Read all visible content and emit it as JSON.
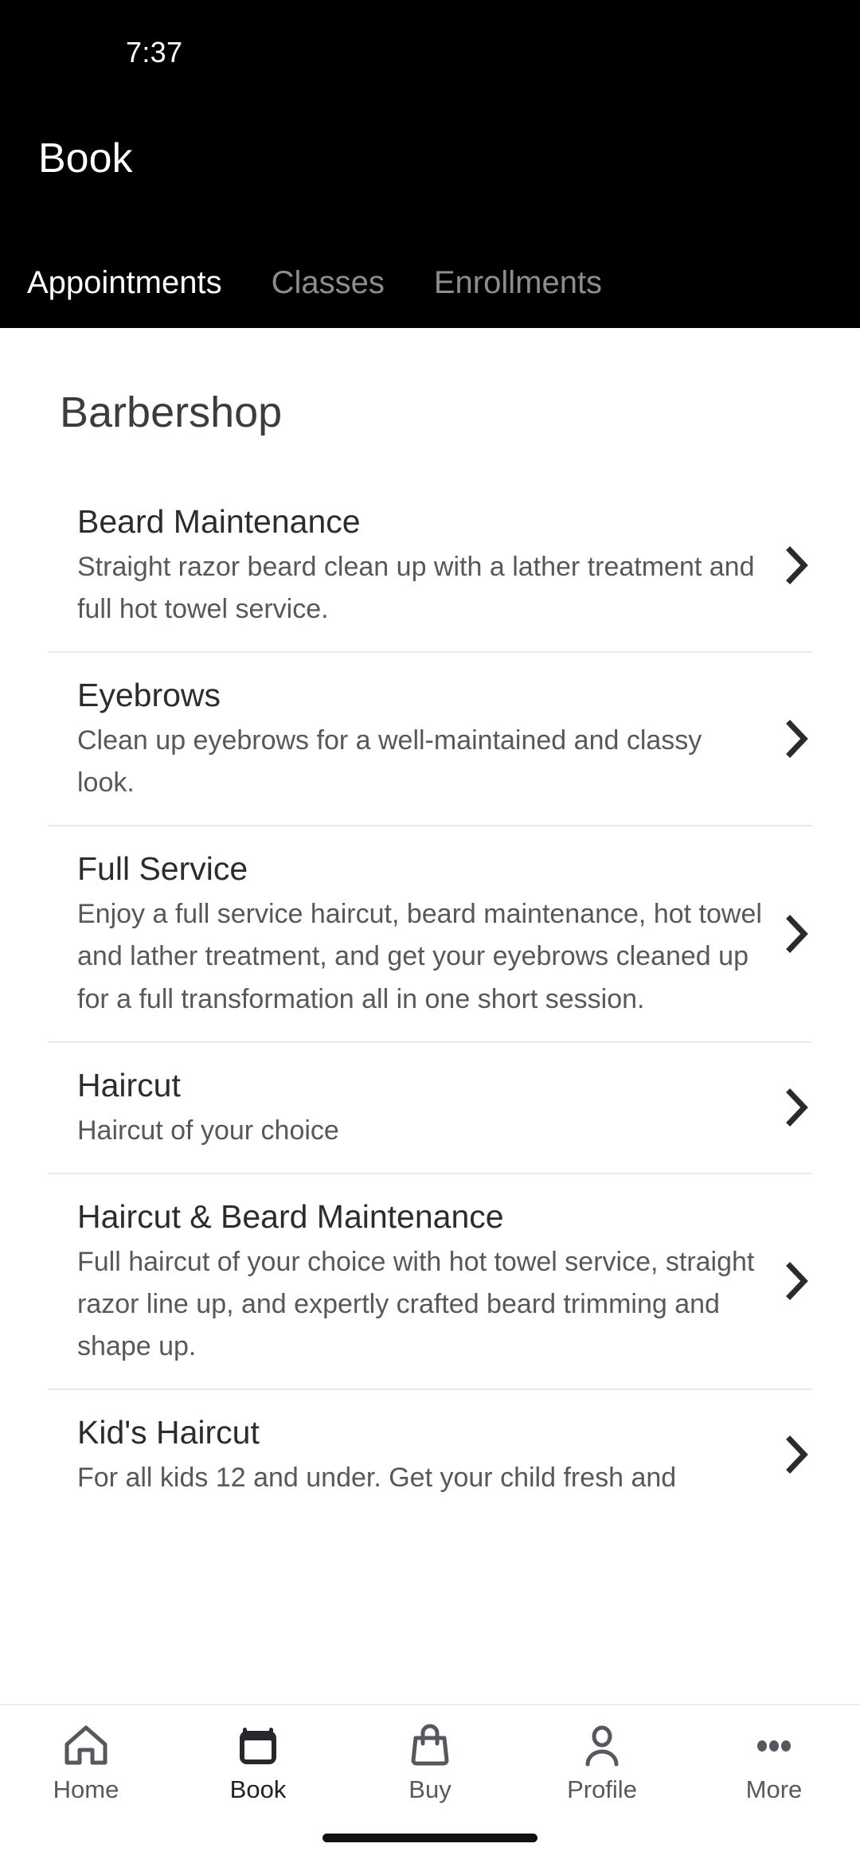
{
  "status_bar": {
    "time": "7:37"
  },
  "header": {
    "title": "Book",
    "background_color": "#000000",
    "tabs": [
      {
        "label": "Appointments",
        "active": true
      },
      {
        "label": "Classes",
        "active": false
      },
      {
        "label": "Enrollments",
        "active": false
      }
    ]
  },
  "main": {
    "section_title": "Barbershop",
    "chevron_icon": "chevron-right-icon",
    "services": [
      {
        "name": "Beard Maintenance",
        "description": "Straight razor beard clean up with a lather treatment and full hot towel service."
      },
      {
        "name": "Eyebrows",
        "description": "Clean up eyebrows for a well-maintained and classy look."
      },
      {
        "name": "Full Service",
        "description": "Enjoy a full service haircut, beard maintenance, hot towel and lather treatment, and get your eyebrows cleaned up for a full transformation all in one short session."
      },
      {
        "name": "Haircut",
        "description": "Haircut of your choice"
      },
      {
        "name": "Haircut & Beard Maintenance",
        "description": "Full haircut of your choice with hot towel service, straight razor line up, and expertly crafted beard trimming and shape up."
      },
      {
        "name": "Kid's Haircut",
        "description": "For all kids 12 and under. Get your child fresh and"
      }
    ]
  },
  "bottom_nav": {
    "items": [
      {
        "label": "Home",
        "icon": "home-icon",
        "active": false
      },
      {
        "label": "Book",
        "icon": "calendar-icon",
        "active": true
      },
      {
        "label": "Buy",
        "icon": "shopping-bag-icon",
        "active": false
      },
      {
        "label": "Profile",
        "icon": "person-icon",
        "active": false
      },
      {
        "label": "More",
        "icon": "ellipsis-icon",
        "active": false
      }
    ]
  },
  "colors": {
    "header_bg": "#000000",
    "page_bg": "#ffffff",
    "active_tab": "#ffffff",
    "inactive_tab": "#8d8d8d",
    "title_text": "#3c3c3c",
    "service_name": "#2c2c2c",
    "service_desc": "#585858",
    "divider": "#e9e9e9",
    "nav_icon": "#55595f",
    "nav_active": "#1f2125"
  }
}
